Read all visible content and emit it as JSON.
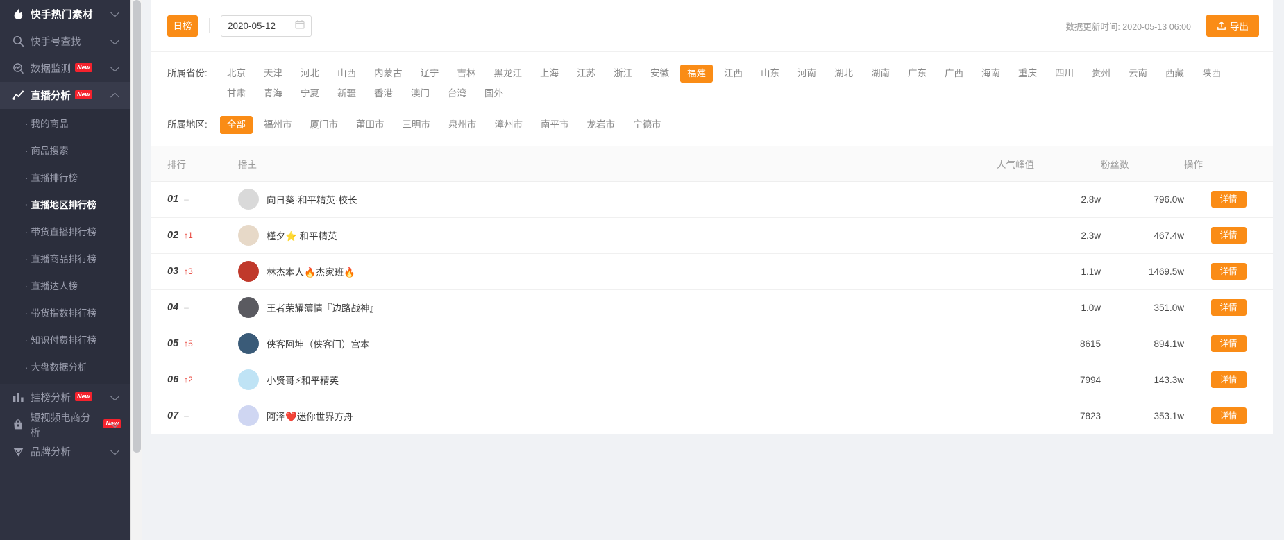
{
  "sidebar": {
    "top": {
      "label": "快手热门素材",
      "icon": "fire-icon",
      "chevron": "chevron-down-icon"
    },
    "items": [
      {
        "label": "快手号查找",
        "icon": "search-icon",
        "badge": "",
        "chevron": "chevron-down-icon",
        "active": false
      },
      {
        "label": "数据监测",
        "icon": "monitor-icon",
        "badge": "New",
        "chevron": "chevron-down-icon",
        "active": false
      },
      {
        "label": "直播分析",
        "icon": "line-chart-icon",
        "badge": "New",
        "chevron": "chevron-up-icon",
        "active": true
      }
    ],
    "submenu": [
      {
        "label": "我的商品",
        "active": false
      },
      {
        "label": "商品搜索",
        "active": false
      },
      {
        "label": "直播排行榜",
        "active": false
      },
      {
        "label": "直播地区排行榜",
        "active": true
      },
      {
        "label": "带货直播排行榜",
        "active": false
      },
      {
        "label": "直播商品排行榜",
        "active": false
      },
      {
        "label": "直播达人榜",
        "active": false
      },
      {
        "label": "带货指数排行榜",
        "active": false
      },
      {
        "label": "知识付费排行榜",
        "active": false
      },
      {
        "label": "大盘数据分析",
        "active": false
      }
    ],
    "items_bottom": [
      {
        "label": "挂榜分析",
        "icon": "bar-chart-icon",
        "badge": "New",
        "chevron": "chevron-down-icon"
      },
      {
        "label": "短视频电商分析",
        "icon": "bag-icon",
        "badge": "New",
        "chevron": "chevron-down-icon"
      },
      {
        "label": "品牌分析",
        "icon": "diamond-icon",
        "badge": "",
        "chevron": "chevron-down-icon"
      }
    ]
  },
  "toolbar": {
    "rank_type_label": "日榜",
    "date_value": "2020-05-12",
    "date_icon": "calendar-icon",
    "update_time": "数据更新时间: 2020-05-13 06:00",
    "export_label": "导出",
    "export_icon": "upload-icon"
  },
  "filters": {
    "province": {
      "label": "所属省份:",
      "selected": "福建",
      "options": [
        "北京",
        "天津",
        "河北",
        "山西",
        "内蒙古",
        "辽宁",
        "吉林",
        "黑龙江",
        "上海",
        "江苏",
        "浙江",
        "安徽",
        "福建",
        "江西",
        "山东",
        "河南",
        "湖北",
        "湖南",
        "广东",
        "广西",
        "海南",
        "重庆",
        "四川",
        "贵州",
        "云南",
        "西藏",
        "陕西",
        "甘肃",
        "青海",
        "宁夏",
        "新疆",
        "香港",
        "澳门",
        "台湾",
        "国外"
      ]
    },
    "region": {
      "label": "所属地区:",
      "selected": "全部",
      "options": [
        "全部",
        "福州市",
        "厦门市",
        "莆田市",
        "三明市",
        "泉州市",
        "漳州市",
        "南平市",
        "龙岩市",
        "宁德市"
      ]
    }
  },
  "table": {
    "columns": [
      "排行",
      "播主",
      "人气峰值",
      "粉丝数",
      "操作"
    ],
    "action_label": "详情",
    "rows": [
      {
        "rank": "01",
        "delta": "–",
        "delta_up": false,
        "name": "向日葵·和平精英·校长",
        "popularity": "2.8w",
        "fans": "796.0w"
      },
      {
        "rank": "02",
        "delta": "↑1",
        "delta_up": true,
        "name": "槿夕⭐ 和平精英",
        "popularity": "2.3w",
        "fans": "467.4w"
      },
      {
        "rank": "03",
        "delta": "↑3",
        "delta_up": true,
        "name": "林杰本人🔥杰家班🔥",
        "popularity": "1.1w",
        "fans": "1469.5w"
      },
      {
        "rank": "04",
        "delta": "–",
        "delta_up": false,
        "name": "王者荣耀薄情『边路战神』",
        "popularity": "1.0w",
        "fans": "351.0w"
      },
      {
        "rank": "05",
        "delta": "↑5",
        "delta_up": true,
        "name": "侠客阿坤（侠客门）宫本",
        "popularity": "8615",
        "fans": "894.1w"
      },
      {
        "rank": "06",
        "delta": "↑2",
        "delta_up": true,
        "name": "小贤哥⚡和平精英",
        "popularity": "7994",
        "fans": "143.3w"
      },
      {
        "rank": "07",
        "delta": "–",
        "delta_up": false,
        "name": "阿泽❤️迷你世界方舟",
        "popularity": "7823",
        "fans": "353.1w"
      }
    ]
  },
  "colors": {
    "accent": "#fa8c16",
    "sidebar_bg": "#2f3241",
    "badge": "#f5222d",
    "delta_up": "#e8453c"
  }
}
